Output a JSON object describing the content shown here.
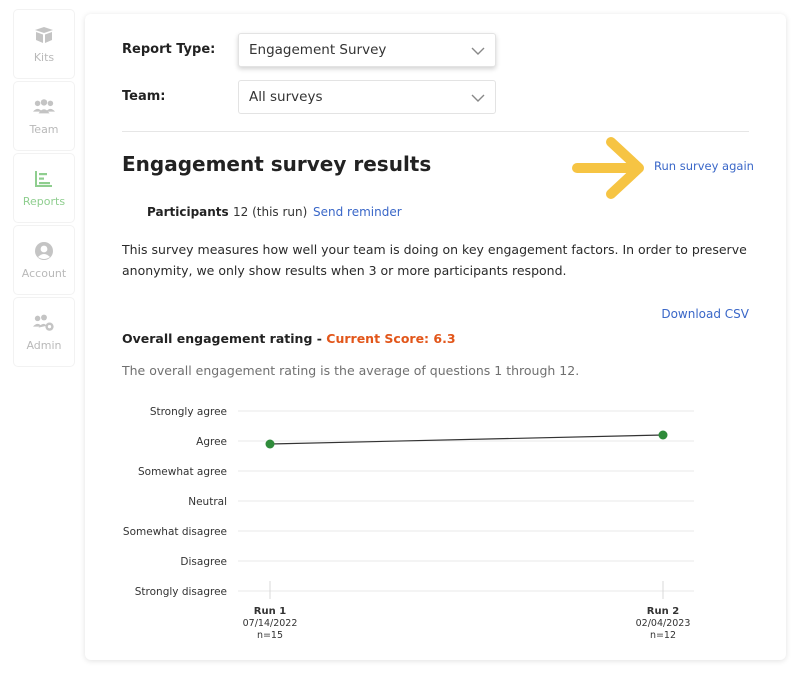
{
  "sidebar": {
    "items": [
      {
        "label": "Kits",
        "icon": "box-icon",
        "active": false
      },
      {
        "label": "Team",
        "icon": "people-icon",
        "active": false
      },
      {
        "label": "Reports",
        "icon": "bar-chart-icon",
        "active": true
      },
      {
        "label": "Account",
        "icon": "person-circle-icon",
        "active": false
      },
      {
        "label": "Admin",
        "icon": "people-gear-icon",
        "active": false
      }
    ]
  },
  "filters": {
    "report_type_label": "Report Type:",
    "report_type_value": "Engagement Survey",
    "team_label": "Team:",
    "team_value": "All surveys"
  },
  "results": {
    "title": "Engagement survey results",
    "run_again": "Run survey again",
    "participants_label": "Participants",
    "participants_value": "12 (this run)",
    "send_reminder": "Send reminder",
    "description": "This survey measures how well your team is doing on key engagement factors. In order to preserve anonymity, we only show results when 3 or more participants respond.",
    "download_csv": "Download CSV",
    "rating_title": "Overall engagement rating - ",
    "current_score": "Current Score: 6.3",
    "rating_description": "The overall engagement rating is the average of questions 1 through 12."
  },
  "colors": {
    "accent_link": "#3a67c8",
    "score": "#e2561a",
    "arrow": "#f6c443",
    "point": "#2e8b3a",
    "active_nav": "#8fce8f"
  },
  "chart_data": {
    "type": "line",
    "y_levels": [
      "Strongly agree",
      "Agree",
      "Somewhat agree",
      "Neutral",
      "Somewhat disagree",
      "Disagree",
      "Strongly disagree"
    ],
    "x": [
      {
        "run": "Run 1",
        "date": "07/14/2022",
        "n": "n=15"
      },
      {
        "run": "Run 2",
        "date": "02/04/2023",
        "n": "n=12"
      }
    ],
    "series": [
      {
        "values": [
          5.9,
          6.2
        ]
      }
    ],
    "ylim": [
      1,
      7
    ],
    "grid": true
  }
}
